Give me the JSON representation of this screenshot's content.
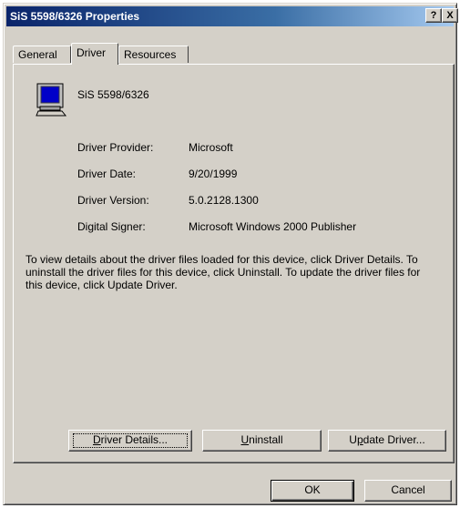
{
  "window": {
    "title": "SiS 5598/6326 Properties",
    "help_glyph": "?",
    "close_glyph": "X"
  },
  "tabs": [
    {
      "label": "General"
    },
    {
      "label": "Driver"
    },
    {
      "label": "Resources"
    }
  ],
  "device": {
    "icon": "monitor-icon",
    "name": "SiS 5598/6326"
  },
  "driver_info": [
    {
      "label": "Driver Provider:",
      "value": "Microsoft"
    },
    {
      "label": "Driver Date:",
      "value": "9/20/1999"
    },
    {
      "label": "Driver Version:",
      "value": "5.0.2128.1300"
    },
    {
      "label": "Digital Signer:",
      "value": "Microsoft Windows 2000 Publisher"
    }
  ],
  "description": "To view details about the driver files loaded for this device, click Driver Details. To uninstall the driver files for this device, click Uninstall. To update the driver files for this device, click Update Driver.",
  "buttons": {
    "details": {
      "mnemonic": "D",
      "rest": "river Details..."
    },
    "uninstall": {
      "mnemonic": "U",
      "rest": "ninstall"
    },
    "update": {
      "pre": "U",
      "mnemonic": "p",
      "rest": "date Driver..."
    },
    "ok": "OK",
    "cancel": "Cancel"
  },
  "colors": {
    "face": "#d4d0c8",
    "title_start": "#0a246a",
    "title_end": "#a6caf0"
  }
}
